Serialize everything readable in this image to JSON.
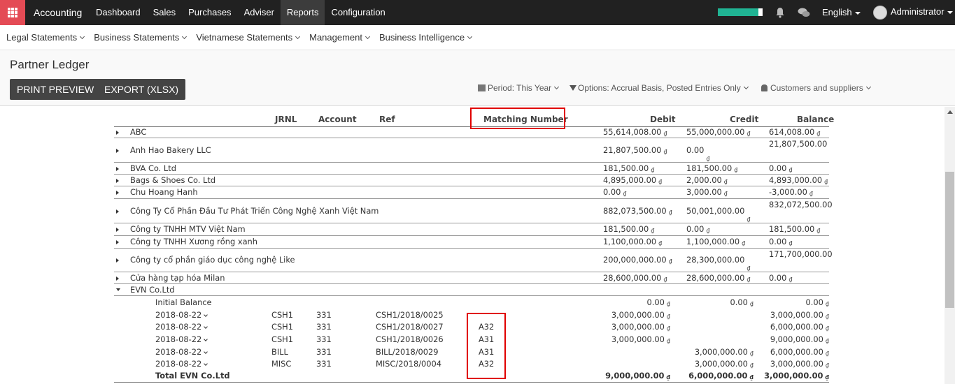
{
  "topbar": {
    "app_title": "Accounting",
    "menu": [
      "Dashboard",
      "Sales",
      "Purchases",
      "Adviser",
      "Reports",
      "Configuration"
    ],
    "active_menu": "Reports",
    "progress_fraction": 0.9,
    "progress_color": "#20b393",
    "language": "English",
    "user": "Administrator"
  },
  "submenu": [
    "Legal Statements",
    "Business Statements",
    "Vietnamese Statements",
    "Management",
    "Business Intelligence"
  ],
  "control_panel": {
    "title": "Partner Ledger",
    "print_button": "PRINT PREVIEW",
    "export_button": "EXPORT (XLSX)",
    "filter_period": "Period: This Year",
    "filter_options": "Options: Accrual Basis, Posted Entries Only",
    "filter_partners": "Customers and suppliers"
  },
  "table": {
    "headers": {
      "jrnl": "JRNL",
      "account": "Account",
      "ref": "Ref",
      "matching": "Matching Number",
      "debit": "Debit",
      "credit": "Credit",
      "balance": "Balance"
    },
    "currency": "₫",
    "partners": [
      {
        "name": "ABC",
        "debit": "55,614,008.00",
        "credit": "55,000,000.00",
        "balance": "614,008.00"
      },
      {
        "name": "Anh Hao Bakery LLC",
        "debit": "21,807,500.00",
        "credit": "0.00",
        "balance": "21,807,500.00"
      },
      {
        "name": "BVA Co. Ltd",
        "debit": "181,500.00",
        "credit": "181,500.00",
        "balance": "0.00"
      },
      {
        "name": "Bags & Shoes Co. Ltd",
        "debit": "4,895,000.00",
        "credit": "2,000.00",
        "balance": "4,893,000.00"
      },
      {
        "name": "Chu Hoang Hanh",
        "debit": "0.00",
        "credit": "3,000.00",
        "balance": "-3,000.00"
      },
      {
        "name": "Công Ty Cổ Phần Đầu Tư Phát Triển Công Nghệ Xanh Việt Nam",
        "debit": "882,073,500.00",
        "credit": "50,001,000.00",
        "balance": "832,072,500.00"
      },
      {
        "name": "Công ty TNHH MTV Việt Nam",
        "debit": "181,500.00",
        "credit": "0.00",
        "balance": "181,500.00"
      },
      {
        "name": "Công ty TNHH Xương rồng xanh",
        "debit": "1,100,000.00",
        "credit": "1,100,000.00",
        "balance": "0.00"
      },
      {
        "name": "Công ty cổ phần giáo dục công nghệ Like",
        "debit": "200,000,000.00",
        "credit": "28,300,000.00",
        "balance": "171,700,000.00"
      },
      {
        "name": "Cửa hàng tạp hóa Milan",
        "debit": "28,600,000.00",
        "credit": "28,600,000.00",
        "balance": "0.00"
      },
      {
        "name": "EVN Co.Ltd"
      }
    ],
    "evn": {
      "initial": {
        "label": "Initial Balance",
        "debit": "0.00",
        "credit": "0.00",
        "balance": "0.00"
      },
      "lines": [
        {
          "date": "2018-08-22",
          "jrnl": "CSH1",
          "account": "331",
          "ref": "CSH1/2018/0025",
          "matching": "",
          "debit": "3,000,000.00",
          "credit": "",
          "balance": "3,000,000.00"
        },
        {
          "date": "2018-08-22",
          "jrnl": "CSH1",
          "account": "331",
          "ref": "CSH1/2018/0027",
          "matching": "A32",
          "debit": "3,000,000.00",
          "credit": "",
          "balance": "6,000,000.00"
        },
        {
          "date": "2018-08-22",
          "jrnl": "CSH1",
          "account": "331",
          "ref": "CSH1/2018/0026",
          "matching": "A31",
          "debit": "3,000,000.00",
          "credit": "",
          "balance": "9,000,000.00"
        },
        {
          "date": "2018-08-22",
          "jrnl": "BILL",
          "account": "331",
          "ref": "BILL/2018/0029",
          "matching": "A31",
          "debit": "",
          "credit": "3,000,000.00",
          "balance": "6,000,000.00"
        },
        {
          "date": "2018-08-22",
          "jrnl": "MISC",
          "account": "331",
          "ref": "MISC/2018/0004",
          "matching": "A32",
          "debit": "",
          "credit": "3,000,000.00",
          "balance": "3,000,000.00"
        }
      ],
      "total": {
        "label": "Total EVN Co.Ltd",
        "debit": "9,000,000.00",
        "credit": "6,000,000.00",
        "balance": "3,000,000.00"
      }
    }
  }
}
